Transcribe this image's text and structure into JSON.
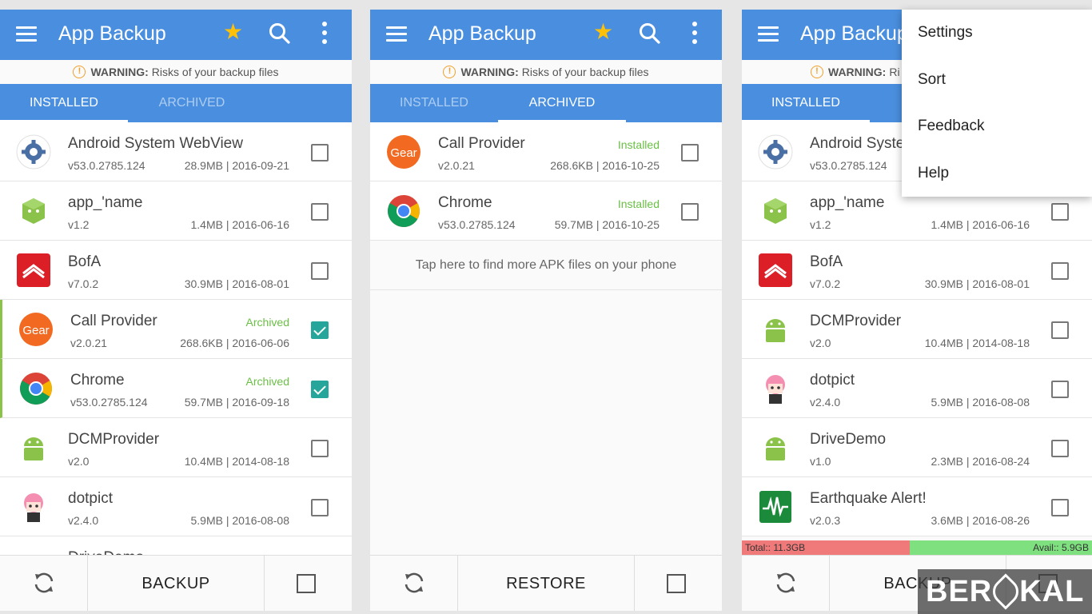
{
  "app_title": "App Backup",
  "warning": {
    "label": "WARNING:",
    "text": "Risks of your backup files"
  },
  "tabs": {
    "installed": "INSTALLED",
    "archived": "ARCHIVED"
  },
  "panel1": {
    "rows": [
      {
        "name": "Android System WebView",
        "version": "v53.0.2785.124",
        "meta": "28.9MB | 2016-09-21",
        "status": "",
        "checked": false
      },
      {
        "name": "app_'name",
        "version": "v1.2",
        "meta": "1.4MB | 2016-06-16",
        "status": "",
        "checked": false
      },
      {
        "name": "BofA",
        "version": "v7.0.2",
        "meta": "30.9MB | 2016-08-01",
        "status": "",
        "checked": false
      },
      {
        "name": "Call Provider",
        "version": "v2.0.21",
        "meta": "268.6KB | 2016-06-06",
        "status": "Archived",
        "checked": true
      },
      {
        "name": "Chrome",
        "version": "v53.0.2785.124",
        "meta": "59.7MB | 2016-09-18",
        "status": "Archived",
        "checked": true
      },
      {
        "name": "DCMProvider",
        "version": "v2.0",
        "meta": "10.4MB | 2014-08-18",
        "status": "",
        "checked": false
      },
      {
        "name": "dotpict",
        "version": "v2.4.0",
        "meta": "5.9MB | 2016-08-08",
        "status": "",
        "checked": false
      }
    ],
    "partial_row": "DriveDemo",
    "action": "BACKUP"
  },
  "panel2": {
    "rows": [
      {
        "name": "Call Provider",
        "version": "v2.0.21",
        "meta": "268.6KB | 2016-10-25",
        "status": "Installed",
        "checked": false
      },
      {
        "name": "Chrome",
        "version": "v53.0.2785.124",
        "meta": "59.7MB | 2016-10-25",
        "status": "Installed",
        "checked": false
      }
    ],
    "tap_message": "Tap here to find more APK files on your phone",
    "action": "RESTORE"
  },
  "panel3": {
    "app_title_visible": "App Backup",
    "warning_visible": "Ri",
    "rows": [
      {
        "name": "Android Syste",
        "version": "v53.0.2785.124",
        "meta": "",
        "status": "",
        "checked": false
      },
      {
        "name": "app_'name",
        "version": "v1.2",
        "meta": "1.4MB | 2016-06-16",
        "status": "",
        "checked": false
      },
      {
        "name": "BofA",
        "version": "v7.0.2",
        "meta": "30.9MB | 2016-08-01",
        "status": "",
        "checked": false
      },
      {
        "name": "DCMProvider",
        "version": "v2.0",
        "meta": "10.4MB | 2014-08-18",
        "status": "",
        "checked": false
      },
      {
        "name": "dotpict",
        "version": "v2.4.0",
        "meta": "5.9MB | 2016-08-08",
        "status": "",
        "checked": false
      },
      {
        "name": "DriveDemo",
        "version": "v1.0",
        "meta": "2.3MB | 2016-08-24",
        "status": "",
        "checked": false
      },
      {
        "name": "Earthquake Alert!",
        "version": "v2.0.3",
        "meta": "3.6MB | 2016-08-26",
        "status": "",
        "checked": false
      }
    ],
    "storage": {
      "total": "Total:: 11.3GB",
      "avail": "Avail:: 5.9GB",
      "used_fraction": 0.48
    },
    "action": "BACKUP"
  },
  "overflow_menu": [
    "Settings",
    "Sort",
    "Feedback",
    "Help"
  ],
  "watermark": {
    "left": "BER",
    "right": "KAL"
  },
  "colors": {
    "primary": "#4a8fdf",
    "accent_check": "#26a69a",
    "status_green": "#6abf45",
    "star": "#ffc107"
  }
}
